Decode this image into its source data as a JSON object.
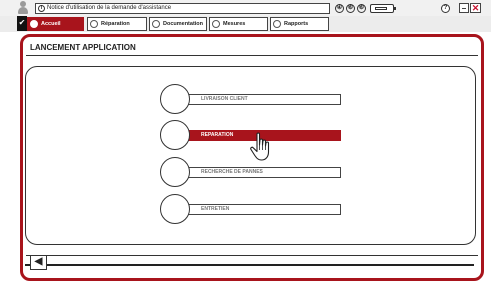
{
  "window": {
    "title": "Notice d'utilisation de la demande d'assistance",
    "info_icon": "i",
    "status_icons": [
      "④",
      "⑥",
      "⑥"
    ],
    "help_icon": "?",
    "close_icon": "✕"
  },
  "tabs": [
    {
      "label": "Accueil",
      "active": true
    },
    {
      "label": "Réparation",
      "active": false
    },
    {
      "label": "Documentation",
      "active": false
    },
    {
      "label": "Mesures",
      "active": false
    },
    {
      "label": "Rapports",
      "active": false
    }
  ],
  "main": {
    "title": "LANCEMENT APPLICATION",
    "menu": [
      {
        "label": "LIVRAISON CLIENT",
        "selected": false
      },
      {
        "label": "REPARATION",
        "selected": true
      },
      {
        "label": "RECHERCHE DE PANNES",
        "selected": false
      },
      {
        "label": "ENTRETIEN",
        "selected": false
      }
    ]
  },
  "footer": {
    "back_icon": "◀"
  },
  "colors": {
    "accent": "#a8141c",
    "background": "#ffffff"
  }
}
